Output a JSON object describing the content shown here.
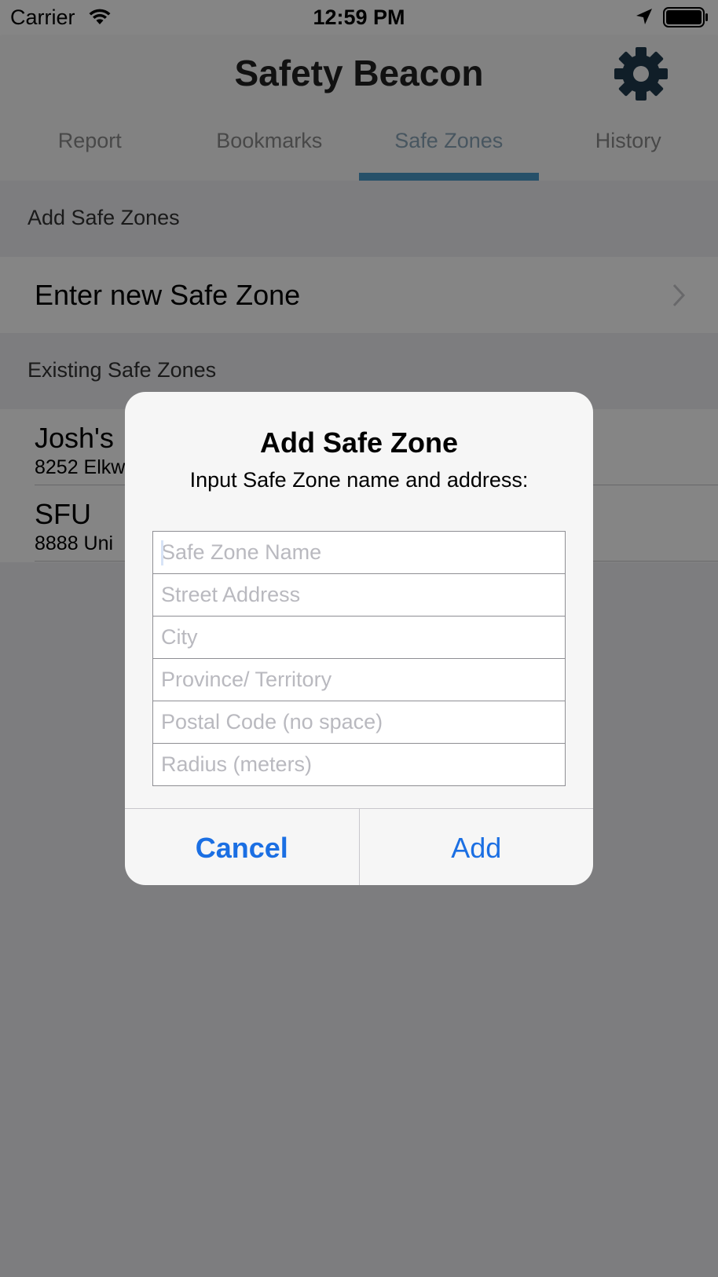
{
  "status_bar": {
    "carrier": "Carrier",
    "time": "12:59 PM"
  },
  "header": {
    "title": "Safety Beacon",
    "tabs": [
      {
        "label": "Report"
      },
      {
        "label": "Bookmarks"
      },
      {
        "label": "Safe Zones",
        "active": true
      },
      {
        "label": "History"
      }
    ],
    "accent_color": "#4a9ac9"
  },
  "content": {
    "add_section_title": "Add Safe Zones",
    "enter_new_label": "Enter new Safe Zone",
    "existing_section_title": "Existing Safe Zones",
    "zones": [
      {
        "name": "Josh's",
        "address": "8252 Elkw"
      },
      {
        "name": "SFU",
        "address": "8888 Uni"
      }
    ]
  },
  "alert": {
    "title": "Add Safe Zone",
    "message": "Input Safe Zone name and address:",
    "fields": [
      {
        "placeholder": "Safe Zone Name",
        "value": ""
      },
      {
        "placeholder": "Street Address",
        "value": ""
      },
      {
        "placeholder": "City",
        "value": ""
      },
      {
        "placeholder": "Province/ Territory",
        "value": ""
      },
      {
        "placeholder": "Postal Code (no space)",
        "value": ""
      },
      {
        "placeholder": "Radius (meters)",
        "value": ""
      }
    ],
    "cancel_label": "Cancel",
    "add_label": "Add",
    "button_color": "#1b6fe3"
  }
}
